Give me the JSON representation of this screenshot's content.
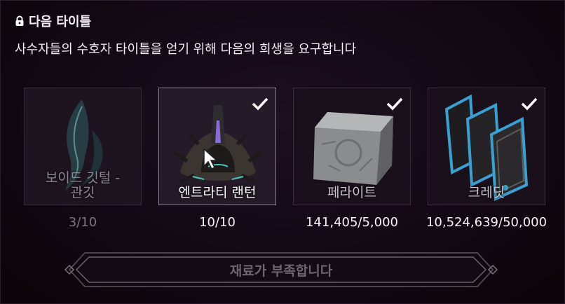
{
  "header": {
    "title": "다음 타이틀",
    "description": "사수자들의 수호자 타이틀을 얻기 위해 다음의 희생을 요구합니다"
  },
  "items": [
    {
      "name": "보이드 깃털 -\n관깃",
      "count": "3/10",
      "state": "locked",
      "checked": false,
      "icon": "void-feather-icon"
    },
    {
      "name": "엔트라티 랜턴",
      "count": "10/10",
      "state": "selected",
      "checked": true,
      "icon": "entrati-lantern-icon"
    },
    {
      "name": "페라이트",
      "count": "141,405/5,000",
      "state": "normal",
      "checked": true,
      "icon": "ferrite-icon"
    },
    {
      "name": "크레딧",
      "count": "10,524,639/50,000",
      "state": "normal",
      "checked": true,
      "icon": "credits-icon"
    }
  ],
  "action": {
    "label": "재료가 부족합니다"
  },
  "colors": {
    "background": "#120914",
    "card_border": "#3b2c3c",
    "disabled_text": "#6e6470",
    "frame": "#6a626c"
  }
}
